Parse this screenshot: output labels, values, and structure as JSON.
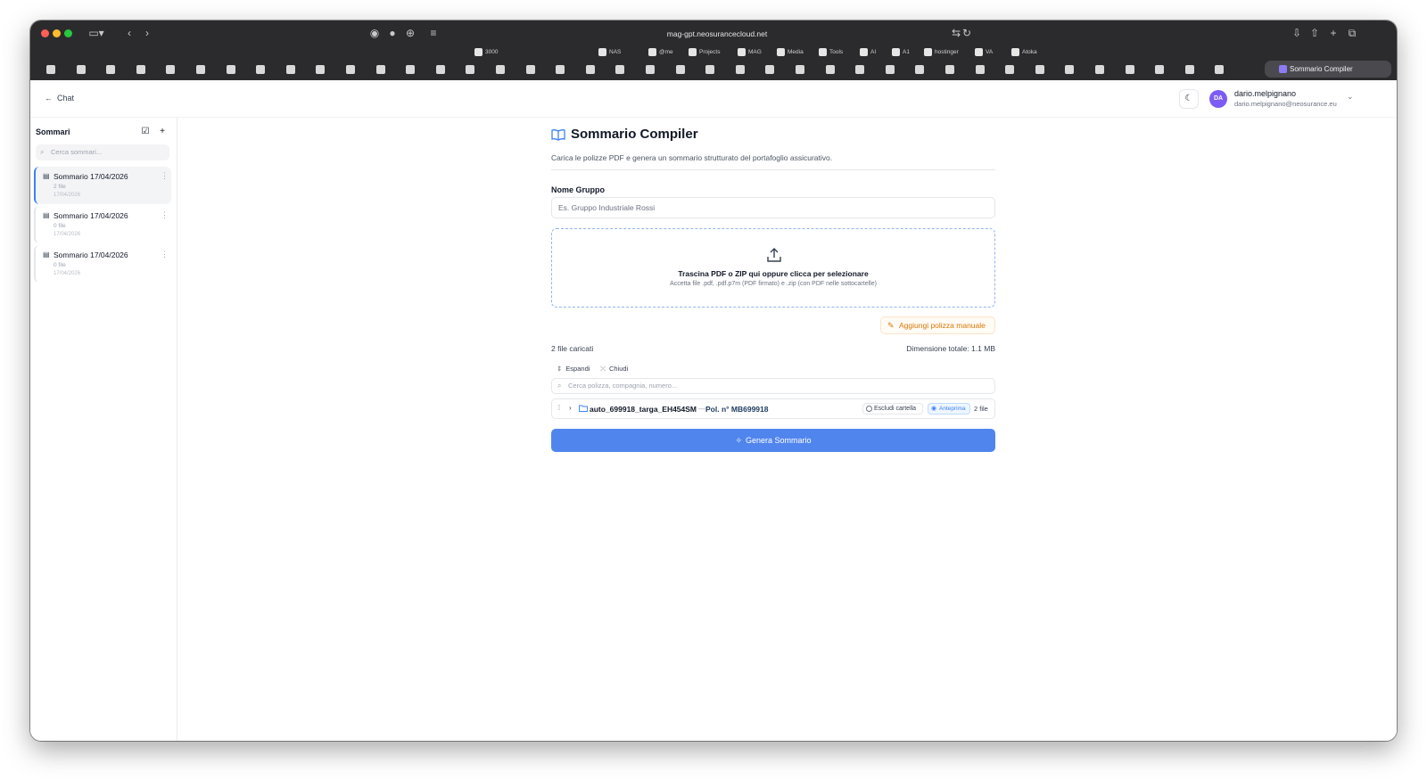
{
  "browser": {
    "url": "mag-gpt.neosurancecloud.net",
    "bookmarks": [
      "3000",
      "NAS",
      "@me",
      "Projects",
      "MAG",
      "Media",
      "Tools",
      "AI",
      "A1",
      "hostinger",
      "VA",
      "Atoka"
    ],
    "active_tab": "Sommario Compiler"
  },
  "header": {
    "back_label": "Chat",
    "user_initials": "DA",
    "user_name": "dario.melpignano",
    "user_email": "dario.melpignano@neosurance.eu"
  },
  "sidebar": {
    "title": "Sommari",
    "search_placeholder": "Cerca sommari...",
    "items": [
      {
        "name": "Sommario 17/04/2026",
        "files": "2 file",
        "date": "17/04/2026",
        "active": true
      },
      {
        "name": "Sommario 17/04/2026",
        "files": "0 file",
        "date": "17/04/2026",
        "active": false
      },
      {
        "name": "Sommario 17/04/2026",
        "files": "0 file",
        "date": "17/04/2026",
        "active": false
      }
    ]
  },
  "main": {
    "title": "Sommario Compiler",
    "subtitle": "Carica le polizze PDF e genera un sommario strutturato del portafoglio assicurativo.",
    "group_label": "Nome Gruppo",
    "group_placeholder": "Es. Gruppo Industriale Rossi",
    "dropzone_title": "Trascina PDF o ZIP qui oppure clicca per selezionare",
    "dropzone_sub": "Accetta file .pdf, .pdf.p7m (PDF firmato) e .zip (con PDF nelle sottocartelle)",
    "manual_button": "Aggiungi polizza manuale",
    "files_count": "2 file caricati",
    "total_size": "Dimensione totale: 1.1 MB",
    "expand_label": "Espandi",
    "collapse_label": "Chiudi",
    "file_search_placeholder": "Cerca polizza, compagnia, numero...",
    "folder": {
      "name": "auto_699918_targa_EH454SM",
      "separator": "—",
      "policy": "Pol. n° MB699918",
      "exclude_label": "Escludi cartella",
      "preview_label": "Anteprima",
      "count": "2 file"
    },
    "generate_button": "Genera Sommario"
  },
  "colors": {
    "primary": "#5185ee",
    "accent_orange": "#d97706",
    "avatar": "#7c5cf5"
  }
}
